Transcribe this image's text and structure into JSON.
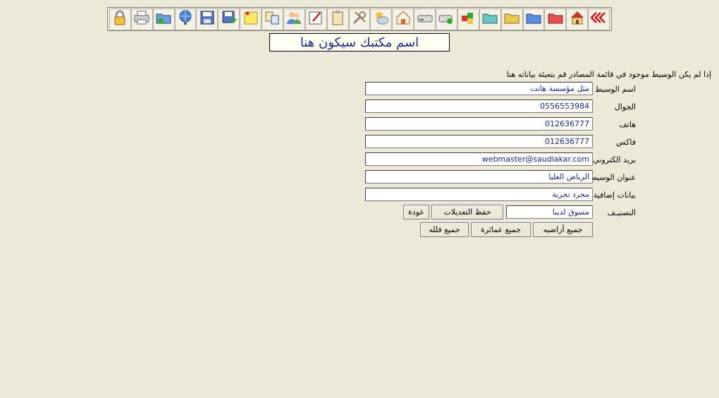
{
  "toolbar": {
    "icons": [
      "back-arrows-icon",
      "home-icon",
      "red-folder-icon",
      "blue-folder-icon",
      "yellow-folder-icon",
      "teal-folder-icon",
      "cubes-icon",
      "drive-add-icon",
      "drive-icon",
      "house-edit-icon",
      "weather-icon",
      "tools-icon",
      "clipboard-icon",
      "edit-note-icon",
      "users-icon",
      "exchange-icon",
      "sticky-note-icon",
      "save-icon",
      "floppy-icon",
      "network-icon",
      "folder-refresh-icon",
      "print-icon",
      "lock-icon"
    ]
  },
  "office_name": "اسم مكتبك سيكون هنا",
  "instruction": "إذا لم يكن الوسيط موجود في قائمة المصادر قم بتعبئة بياناته هنا",
  "form": {
    "broker_name": {
      "label": "اسم الوسيط",
      "value": "مثل مؤسسة هانت"
    },
    "mobile": {
      "label": "الجوال",
      "value": "0556553984"
    },
    "phone": {
      "label": "هاتف",
      "value": "012636777"
    },
    "fax": {
      "label": "فاكس",
      "value": "012636777"
    },
    "email": {
      "label": "بريد الكتروني",
      "value": "webmaster@saudiakar.com"
    },
    "address": {
      "label": "عنوان الوسيط",
      "value": "الرياض العليا"
    },
    "extra": {
      "label": "بيانات إضافية",
      "value": "مجرد تجربة"
    },
    "category": {
      "label": "التصنيـف",
      "value": "مسوق لدينا"
    }
  },
  "buttons": {
    "save": "حفظ التعديلات",
    "back": "عودة",
    "all_lands": "جميع أراضيه",
    "all_buildings": "جميع عمائرة",
    "all_villas": "جميع فلله"
  }
}
